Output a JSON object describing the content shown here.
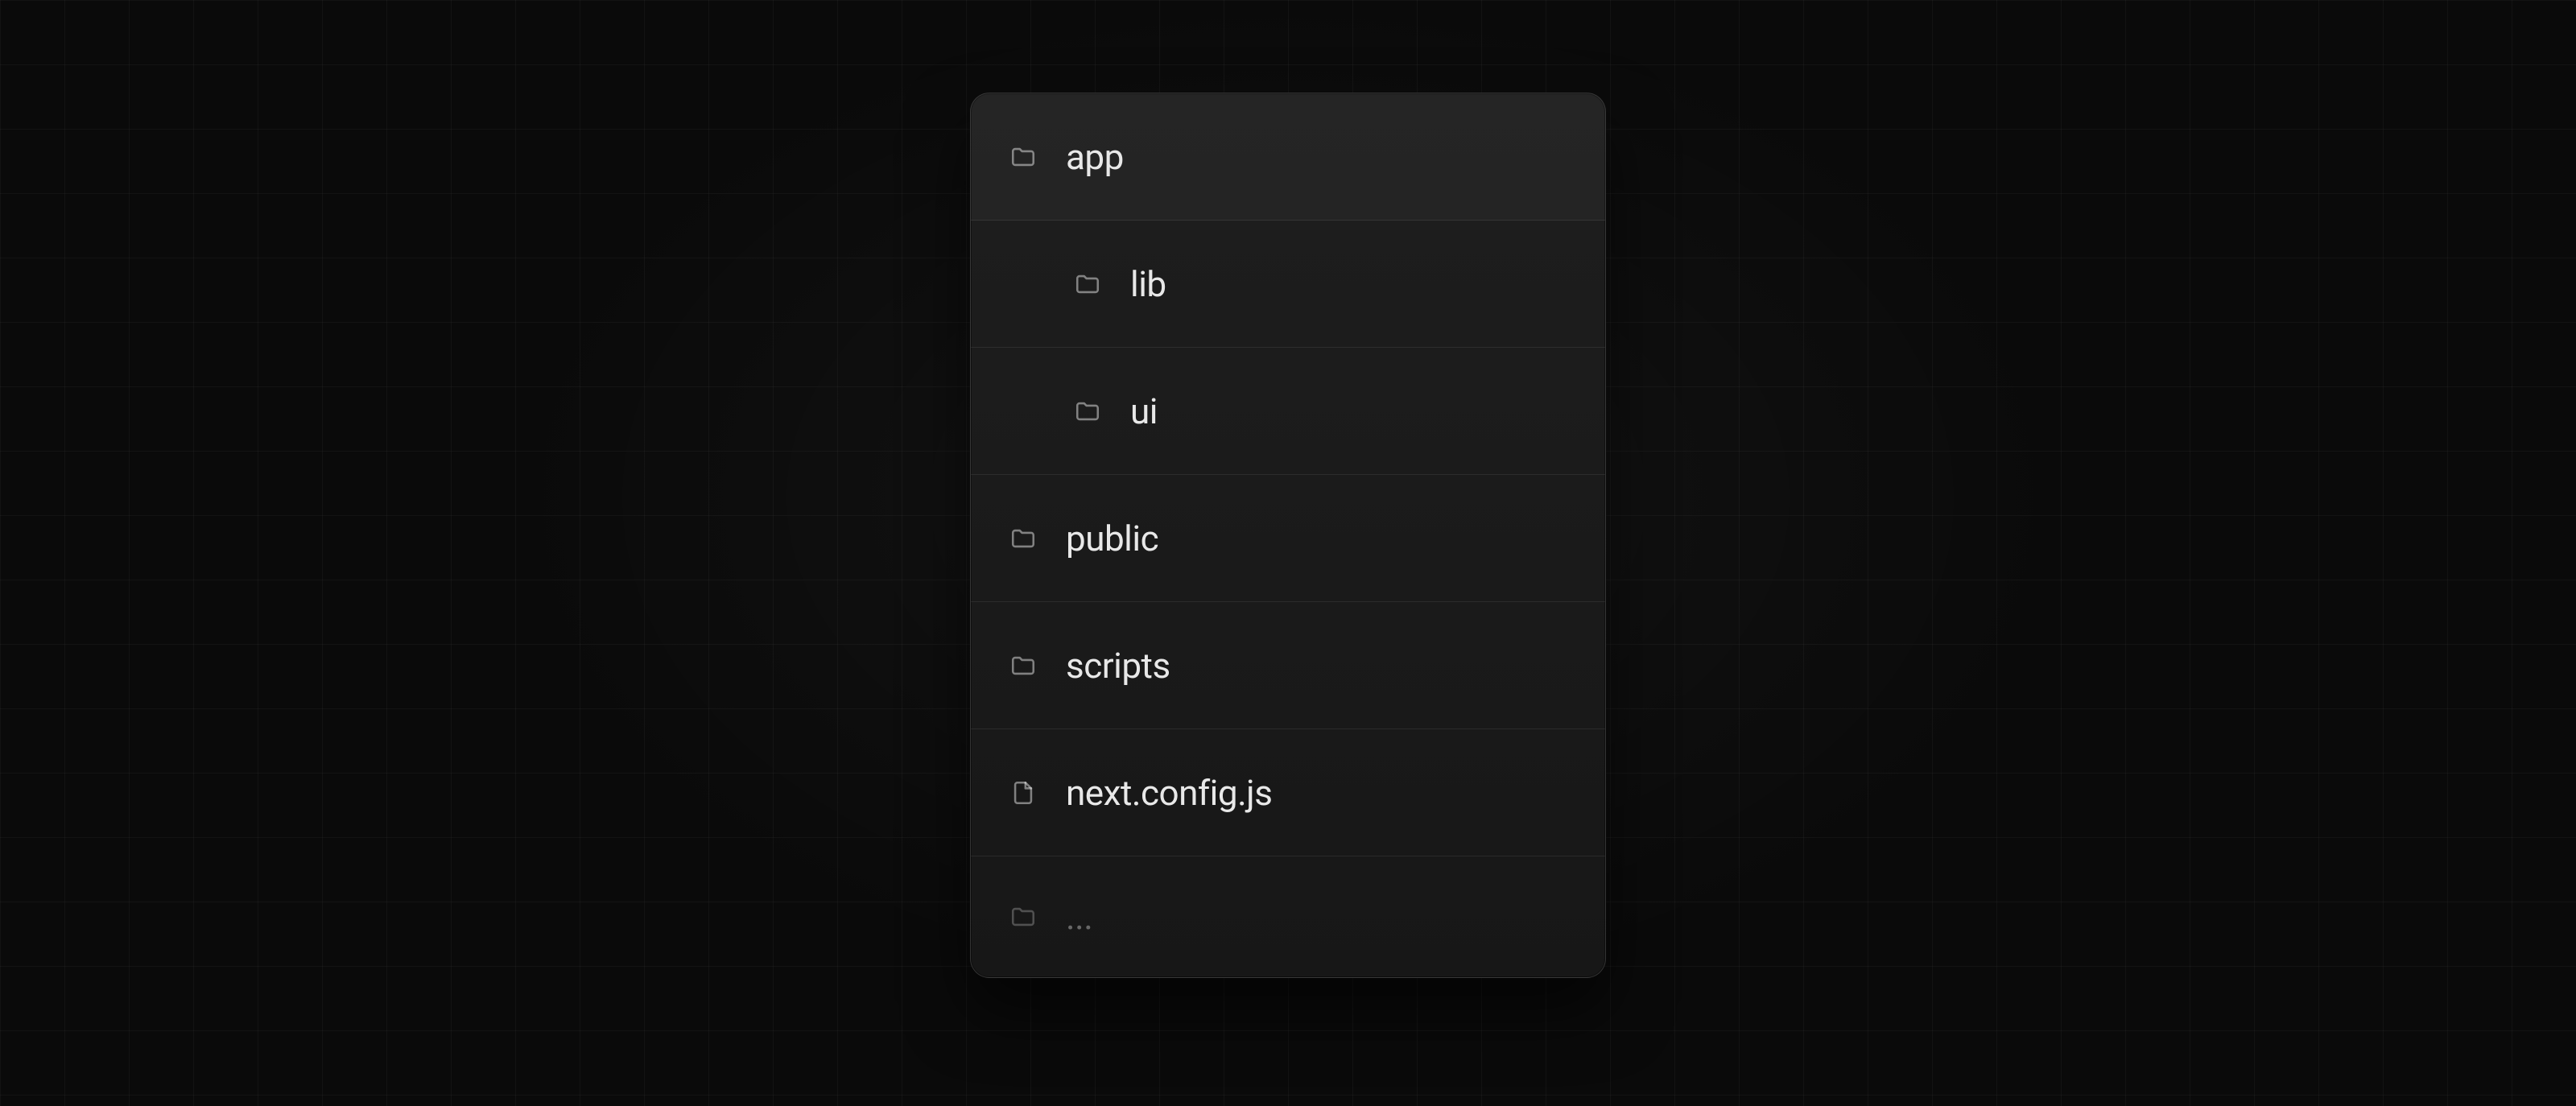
{
  "tree": {
    "items": [
      {
        "label": "app",
        "icon": "folder",
        "depth": 0
      },
      {
        "label": "lib",
        "icon": "folder",
        "depth": 1
      },
      {
        "label": "ui",
        "icon": "folder",
        "depth": 1
      },
      {
        "label": "public",
        "icon": "folder",
        "depth": 0
      },
      {
        "label": "scripts",
        "icon": "folder",
        "depth": 0
      },
      {
        "label": "next.config.js",
        "icon": "file",
        "depth": 0
      },
      {
        "label": "...",
        "icon": "folder",
        "depth": 0,
        "more": true
      }
    ]
  },
  "colors": {
    "background": "#0a0a0a",
    "panel": "#1b1b1b",
    "border": "rgba(255,255,255,0.10)",
    "text": "#e8e8e8",
    "iconStroke": "rgba(255,255,255,0.45)"
  }
}
